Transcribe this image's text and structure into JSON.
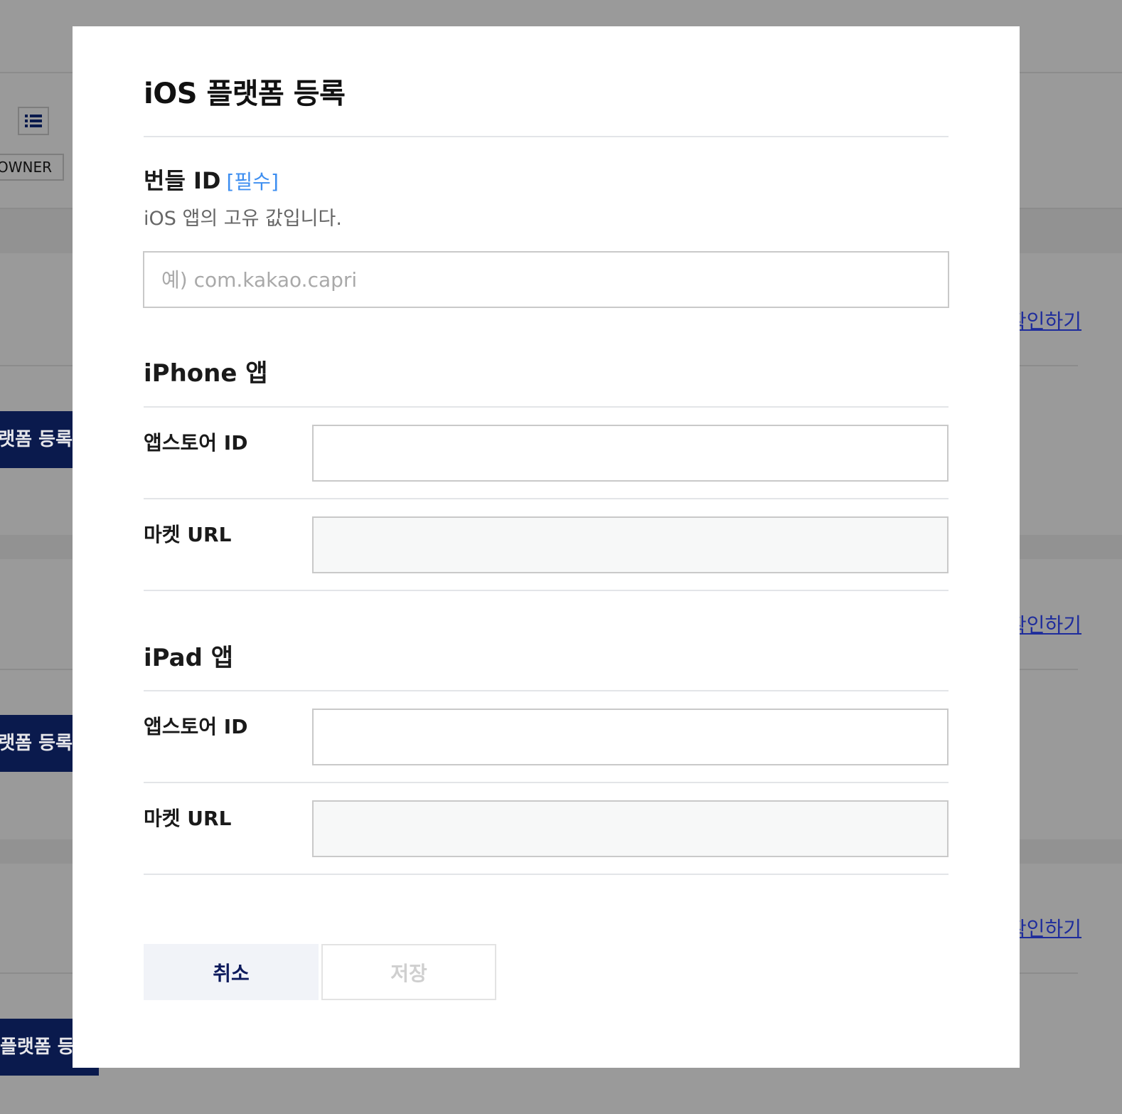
{
  "background": {
    "owner_tag": "OWNER",
    "register_buttons": [
      "플랫폼 등록",
      "플랫폼 등록",
      "플랫폼 등록"
    ],
    "confirm_links": [
      "확인하기",
      "확인하기",
      "확인하기"
    ],
    "icons": {
      "view_toggle": "list-icon"
    }
  },
  "modal": {
    "title": "iOS 플랫폼 등록",
    "bundle": {
      "label": "번들 ID",
      "required_tag": "[필수]",
      "description": "iOS 앱의 고유 값입니다.",
      "placeholder": "예) com.kakao.capri",
      "value": ""
    },
    "iphone": {
      "section_title": "iPhone 앱",
      "appstore_label": "앱스토어 ID",
      "appstore_value": "",
      "market_label": "마켓 URL",
      "market_value": ""
    },
    "ipad": {
      "section_title": "iPad 앱",
      "appstore_label": "앱스토어 ID",
      "appstore_value": "",
      "market_label": "마켓 URL",
      "market_value": ""
    },
    "actions": {
      "cancel_label": "취소",
      "save_label": "저장"
    }
  },
  "colors": {
    "overlay": "#9a9a9a",
    "primary_dark": "#0a1a4d",
    "required_blue": "#3d8ef0",
    "link_blue": "#1e2c9c"
  }
}
